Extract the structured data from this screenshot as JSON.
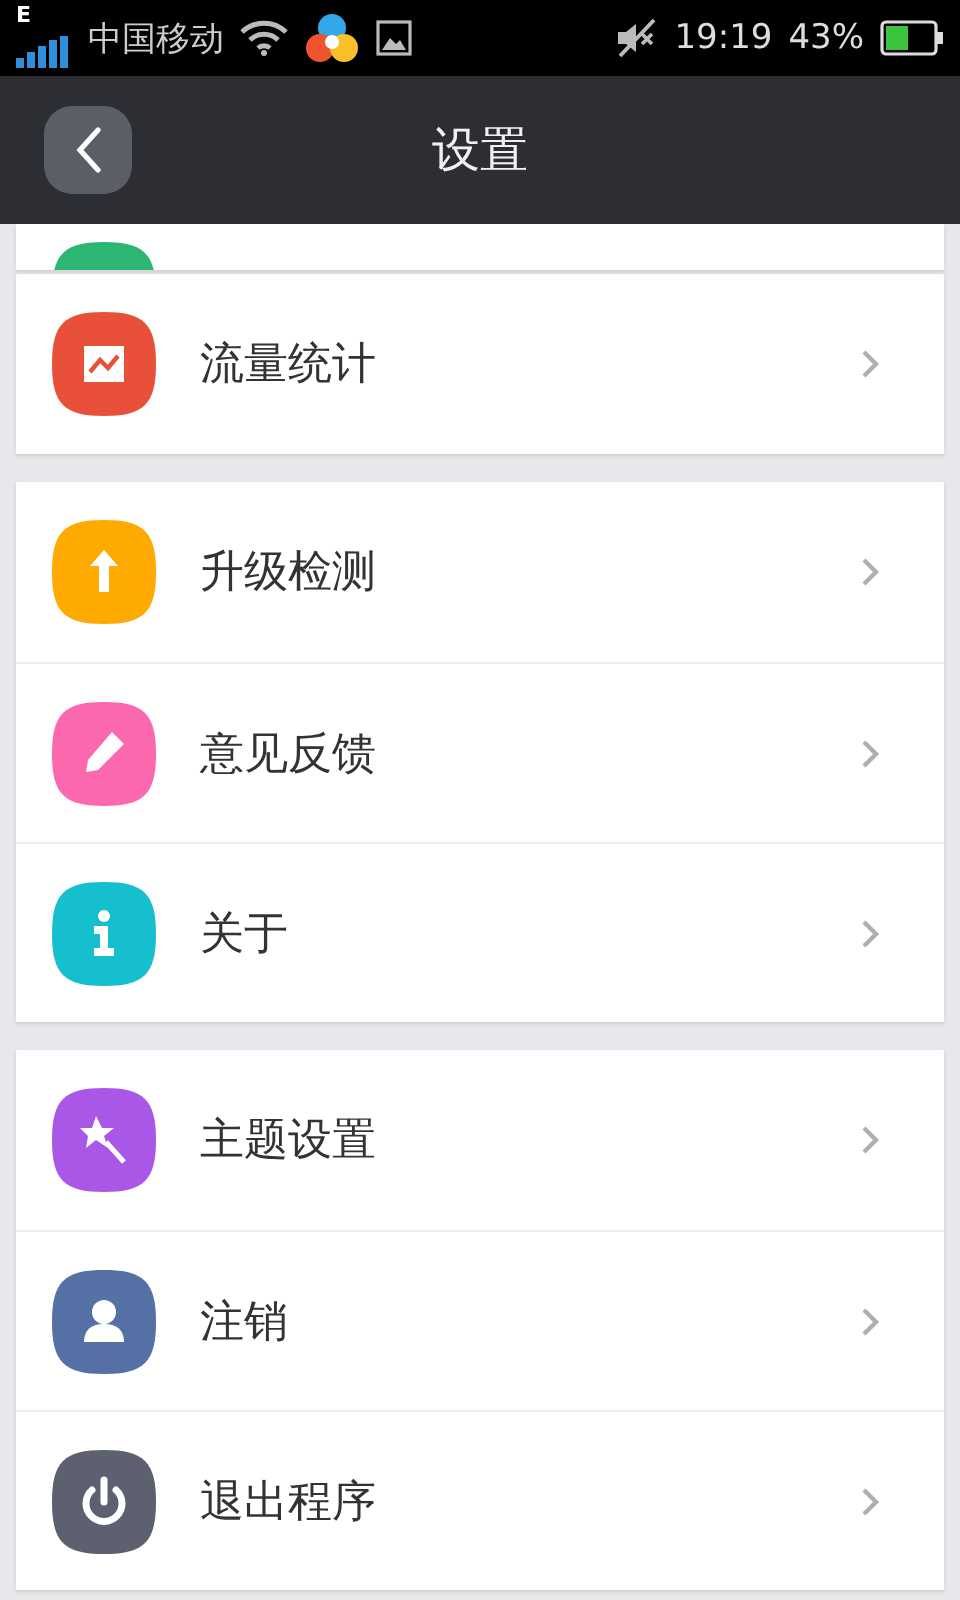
{
  "status_bar": {
    "network": "E",
    "carrier": "中国移动",
    "time": "19:19",
    "battery": "43%"
  },
  "header": {
    "title": "设置"
  },
  "groups": [
    {
      "cut_off": true,
      "items": [
        {
          "color": "#2bb673"
        }
      ]
    },
    {
      "items": [
        {
          "label": "流量统计",
          "kind": "chart",
          "color": "#e8503a"
        }
      ]
    },
    {
      "items": [
        {
          "label": "升级检测",
          "kind": "upload",
          "color": "#ffaa00"
        },
        {
          "label": "意见反馈",
          "kind": "edit",
          "color": "#fb68ad"
        },
        {
          "label": "关于",
          "kind": "info",
          "color": "#16bfcd"
        }
      ]
    },
    {
      "items": [
        {
          "label": "主题设置",
          "kind": "magic",
          "color": "#a957e6"
        },
        {
          "label": "注销",
          "kind": "user",
          "color": "#5470a4"
        },
        {
          "label": "退出程序",
          "kind": "power",
          "color": "#5d606e"
        }
      ]
    }
  ]
}
